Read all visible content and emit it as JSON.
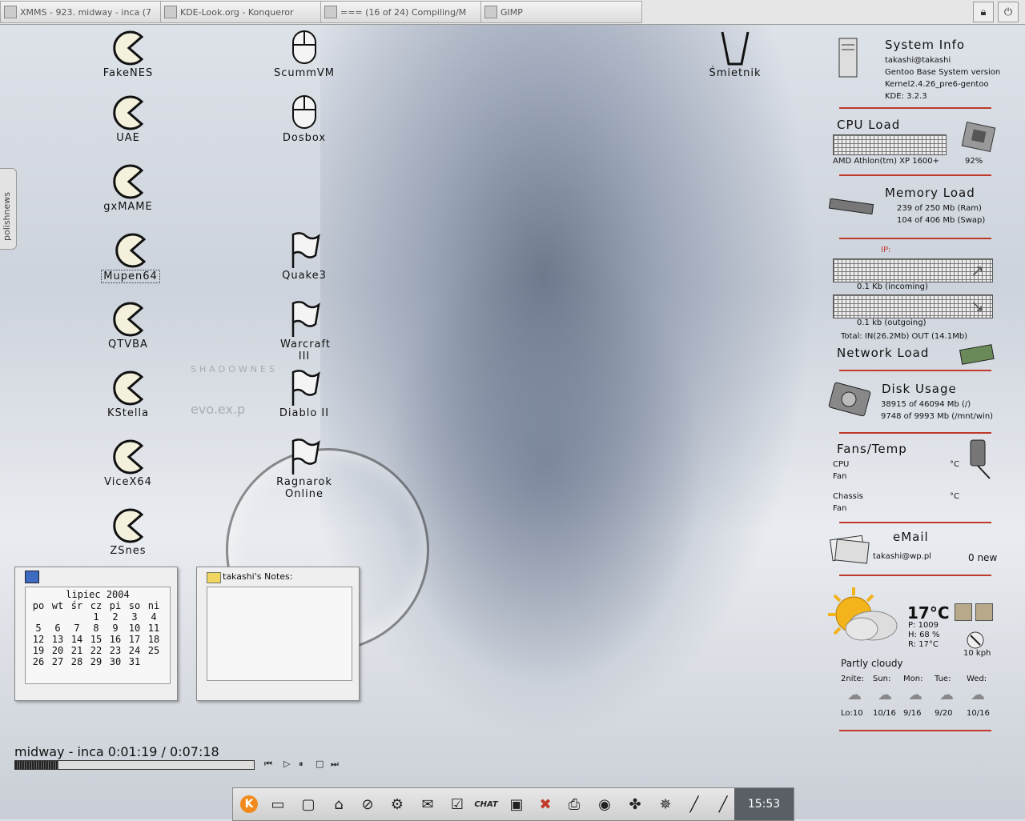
{
  "taskbar": {
    "tasks": [
      {
        "label": "XMMS - 923. midway - inca (7"
      },
      {
        "label": "KDE-Look.org - Konqueror"
      },
      {
        "label": "=== (16 of 24) Compiling/M"
      },
      {
        "label": "GIMP"
      }
    ],
    "lock_icon": "lock-icon",
    "power_icon": "power-icon"
  },
  "side_tab": {
    "label": "polishnews"
  },
  "desktop_icons": [
    {
      "label": "FakeNES",
      "icon": "pacman-icon"
    },
    {
      "label": "UAE",
      "icon": "pacman-icon"
    },
    {
      "label": "gxMAME",
      "icon": "pacman-icon"
    },
    {
      "label": "Mupen64",
      "icon": "pacman-icon"
    },
    {
      "label": "QTVBA",
      "icon": "pacman-icon"
    },
    {
      "label": "KStella",
      "icon": "pacman-icon"
    },
    {
      "label": "ViceX64",
      "icon": "pacman-icon"
    },
    {
      "label": "ZSnes",
      "icon": "pacman-icon"
    },
    {
      "label": "ScummVM",
      "icon": "mouse-icon"
    },
    {
      "label": "Dosbox",
      "icon": "mouse-icon"
    },
    {
      "label": "Quake3",
      "icon": "flag-icon"
    },
    {
      "label": "Warcraft III",
      "icon": "flag-icon"
    },
    {
      "label": "Diablo II",
      "icon": "flag-icon"
    },
    {
      "label": "Ragnarok Online",
      "icon": "flag-icon"
    },
    {
      "label": "Śmietnik",
      "icon": "trash-icon"
    }
  ],
  "wallpaper": {
    "text1": "SHADOWNES",
    "text2": "evo.ex.p"
  },
  "system_info": {
    "title": "System Info",
    "user": "takashi@takashi",
    "distro": "Gentoo Base System version",
    "kernel": "Kernel2.4.26_pre6-gentoo",
    "kde": "KDE: 3.2.3"
  },
  "cpu": {
    "title": "CPU Load",
    "model": "AMD Athlon(tm) XP 1600+",
    "load": "92%"
  },
  "memory": {
    "title": "Memory Load",
    "ram": "239   of 250 Mb (Ram)",
    "swap": "104   of 406 Mb (Swap)"
  },
  "network": {
    "title": "Network Load",
    "ip_label": "IP:",
    "incoming": "0.1 Kb      (incoming)",
    "outgoing": "0.1 kb      (outgoing)",
    "total": "Total: IN(26.2Mb)  OUT (14.1Mb)"
  },
  "disk": {
    "title": "Disk Usage",
    "root": "38915 of 46094 Mb (/)",
    "win": "9748   of 9993 Mb (/mnt/win)"
  },
  "fans": {
    "title": "Fans/Temp",
    "cpu": "CPU",
    "cpu_unit": "°C",
    "fan1": "Fan",
    "chassis": "Chassis",
    "chassis_unit": "°C",
    "fan2": "Fan"
  },
  "email": {
    "title": "eMail",
    "address": "takashi@wp.pl",
    "count": "0 new"
  },
  "weather": {
    "temp": "17°C",
    "pressure": "P: 1009",
    "humidity": "H: 68 %",
    "realfeel": "R: 17°C",
    "wind": "10 kph",
    "condition": "Partly cloudy",
    "forecast": [
      {
        "day": "2nite:",
        "temps": "Lo:10"
      },
      {
        "day": "Sun:",
        "temps": "10/16"
      },
      {
        "day": "Mon:",
        "temps": "9/16"
      },
      {
        "day": "Tue:",
        "temps": "9/20"
      },
      {
        "day": "Wed:",
        "temps": "10/16"
      }
    ]
  },
  "calendar": {
    "month": "lipiec 2004",
    "weekdays": [
      "po",
      "wt",
      "śr",
      "cz",
      "pi",
      "so",
      "ni"
    ],
    "weeks": [
      [
        "",
        "",
        "",
        "1",
        "2",
        "3",
        "4"
      ],
      [
        "5",
        "6",
        "7",
        "8",
        "9",
        "10",
        "11"
      ],
      [
        "12",
        "13",
        "14",
        "15",
        "16",
        "17",
        "18"
      ],
      [
        "19",
        "20",
        "21",
        "22",
        "23",
        "24",
        "25"
      ],
      [
        "26",
        "27",
        "28",
        "29",
        "30",
        "31",
        ""
      ]
    ]
  },
  "notes": {
    "title": "takashi's Notes:",
    "content": ""
  },
  "player": {
    "title": "midway - inca 0:01:19 / 0:07:18",
    "progress": 0.18
  },
  "panel": {
    "icons": [
      "k-menu-icon",
      "desktop-icon",
      "terminal-icon",
      "home-icon",
      "block-icon",
      "network-icon",
      "mail-icon",
      "tasks-icon",
      "chat-icon",
      "floppy-icon",
      "irc-icon",
      "printer-icon",
      "sound-icon",
      "gimp-icon",
      "quake-icon",
      "pen-icon",
      "pen-icon-2"
    ],
    "chat_label": "CHAT",
    "clock": "15:53"
  }
}
